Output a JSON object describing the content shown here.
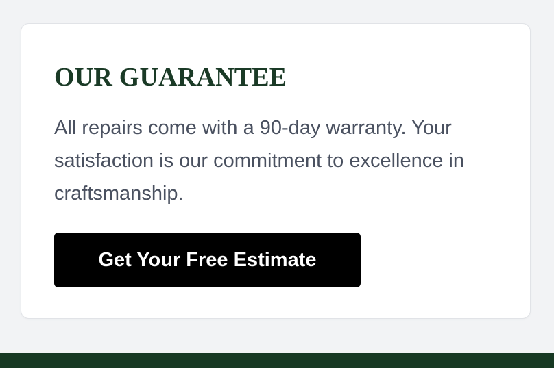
{
  "guarantee": {
    "title": "OUR GUARANTEE",
    "body": "All repairs come with a 90-day warranty. Your satisfaction is our commitment to excellence in craftsmanship.",
    "cta_label": "Get Your Free Estimate"
  },
  "colors": {
    "page_background": "#f2f3f5",
    "card_background": "#ffffff",
    "title_color": "#1a3a26",
    "body_text": "#4a5160",
    "button_background": "#000000",
    "button_text": "#ffffff",
    "footer_background": "#173923"
  }
}
